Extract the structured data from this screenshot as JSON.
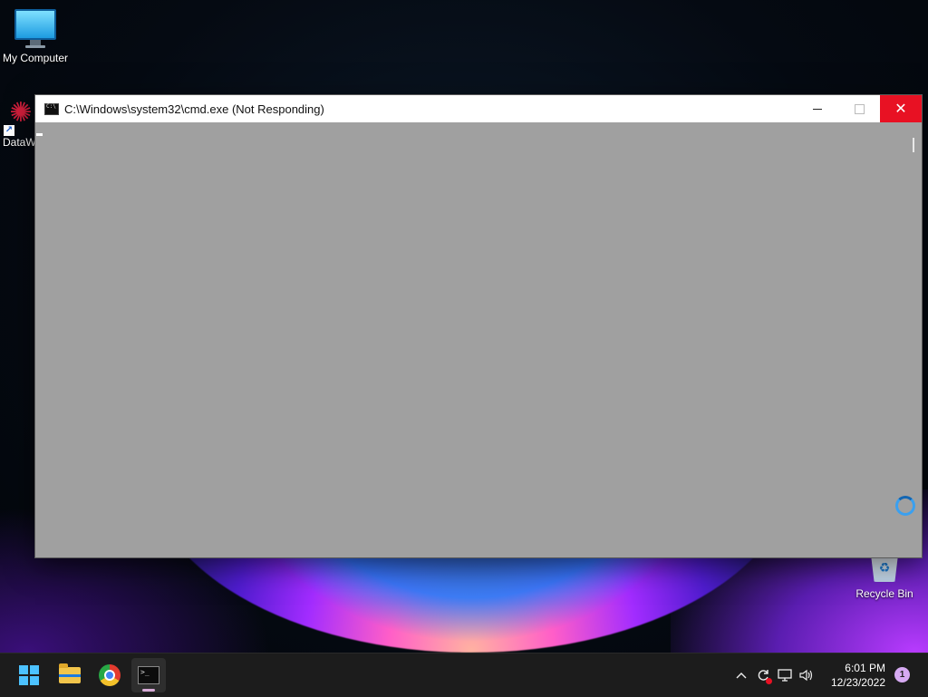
{
  "desktop": {
    "icons": {
      "my_computer": "My Computer",
      "datawave": "DataW",
      "recycle_bin": "Recycle Bin"
    }
  },
  "window": {
    "title": "C:\\Windows\\system32\\cmd.exe (Not Responding)",
    "controls": {
      "minimize": "—",
      "maximize": "",
      "close": "✕"
    }
  },
  "taskbar": {
    "apps": [
      {
        "name": "Start",
        "icon": "windows-start-icon"
      },
      {
        "name": "File Explorer",
        "icon": "folder-icon"
      },
      {
        "name": "Google Chrome",
        "icon": "chrome-icon"
      },
      {
        "name": "Command Prompt",
        "icon": "cmd-icon",
        "active": true
      }
    ],
    "tray": {
      "chevron": "^",
      "time": "6:01 PM",
      "date": "12/23/2022",
      "notification_count": "1"
    }
  },
  "colors": {
    "close_button": "#e81123",
    "window_client": "#a0a0a0",
    "start_accent": "#4cc2ff",
    "taskbar": "#1c1c1c"
  }
}
